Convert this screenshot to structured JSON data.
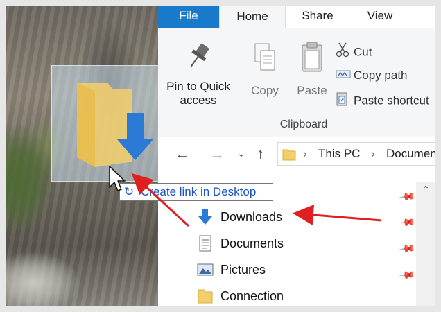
{
  "ribbon_tabs": {
    "file": "File",
    "home": "Home",
    "share": "Share",
    "view": "View"
  },
  "clipboard": {
    "pin_line1": "Pin to Quick",
    "pin_line2": "access",
    "copy": "Copy",
    "paste": "Paste",
    "cut": "Cut",
    "copy_path": "Copy path",
    "paste_shortcut": "Paste shortcut",
    "group_label": "Clipboard"
  },
  "address_bar": {
    "segment1": "This PC",
    "segment2": "Documen"
  },
  "drag_tooltip": {
    "text": "Create link in Desktop"
  },
  "quick_access": [
    {
      "label": "Downloads",
      "icon": "downloads-icon",
      "pinned": true
    },
    {
      "label": "Documents",
      "icon": "documents-icon",
      "pinned": true
    },
    {
      "label": "Pictures",
      "icon": "pictures-icon",
      "pinned": true
    },
    {
      "label": "Connection",
      "icon": "folder-icon",
      "pinned": false
    }
  ],
  "colors": {
    "file_tab": "#1979ca",
    "annotation_arrow": "#e02020",
    "folder": "#f3cf6b",
    "download_arrow": "#2b7bd6"
  }
}
